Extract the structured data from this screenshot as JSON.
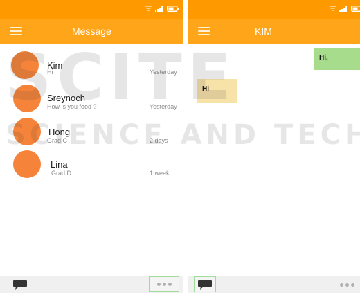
{
  "left_screen": {
    "title": "Message",
    "contacts": [
      {
        "name": "Kim",
        "preview": "Hi",
        "time": "Yesterday"
      },
      {
        "name": "Sreynoch",
        "preview": "How is you food ?",
        "time": "Yesterday"
      },
      {
        "name": "Hong",
        "preview": "Grad C",
        "time": "2 days"
      },
      {
        "name": "Lina",
        "preview": "Grad D",
        "time": "1 week"
      }
    ]
  },
  "right_screen": {
    "title": "KIM",
    "messages": [
      {
        "direction": "outgoing",
        "text": "Hi,"
      },
      {
        "direction": "incoming",
        "text": "Hi"
      }
    ]
  },
  "watermark": {
    "line1": "SCITE",
    "line2": "SCIENCE AND TECH"
  },
  "colors": {
    "statusbar": "#ff9900",
    "appbar": "#ffa51a",
    "avatar": "#f5843a",
    "outgoing_bubble": "#a6dc8c",
    "incoming_bubble": "#f7e2a8",
    "bottombar": "#f0f0f0",
    "focus_outline": "#9edc9a"
  },
  "icons": {
    "status": [
      "wifi-icon",
      "signal-icon",
      "battery-icon"
    ],
    "menu": "hamburger-menu-icon",
    "compose": "chat-bubble-icon",
    "more": "more-dots-icon"
  }
}
